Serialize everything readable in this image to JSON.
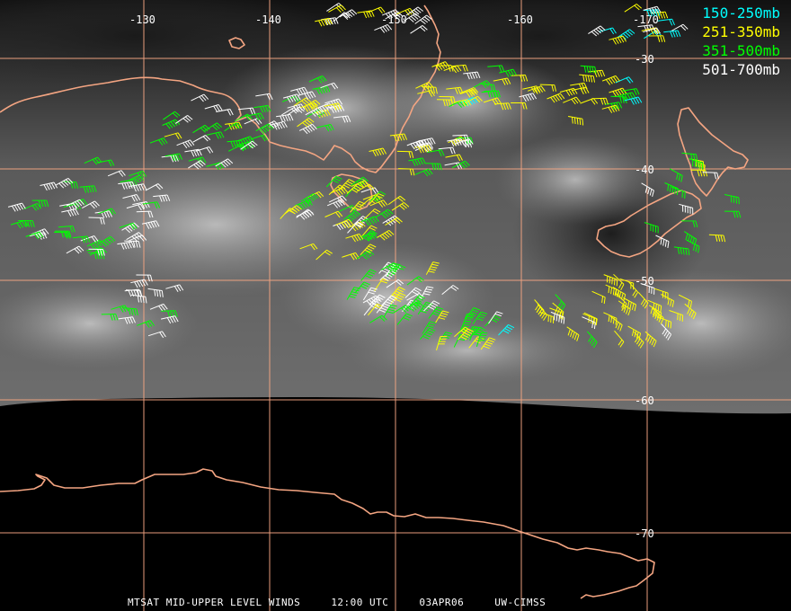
{
  "legend": [
    {
      "label": "150-250mb",
      "color": "#00ffff"
    },
    {
      "label": "251-350mb",
      "color": "#ffff00"
    },
    {
      "label": "351-500mb",
      "color": "#00ff00"
    },
    {
      "label": "501-700mb",
      "color": "#ffffff"
    }
  ],
  "lon_labels": [
    "-130",
    "-140",
    "-150",
    "-160",
    "-170"
  ],
  "lat_labels": [
    "-30",
    "-40",
    "-50",
    "-60",
    "-70"
  ],
  "footer": {
    "product": "MTSAT MID-UPPER LEVEL WINDS",
    "time": "12:00 UTC",
    "date": "03APR06",
    "source": "UW-CIMSS"
  },
  "colors": {
    "background": "#000000",
    "coastline": "#f4a582",
    "grid": "#f4a582"
  }
}
